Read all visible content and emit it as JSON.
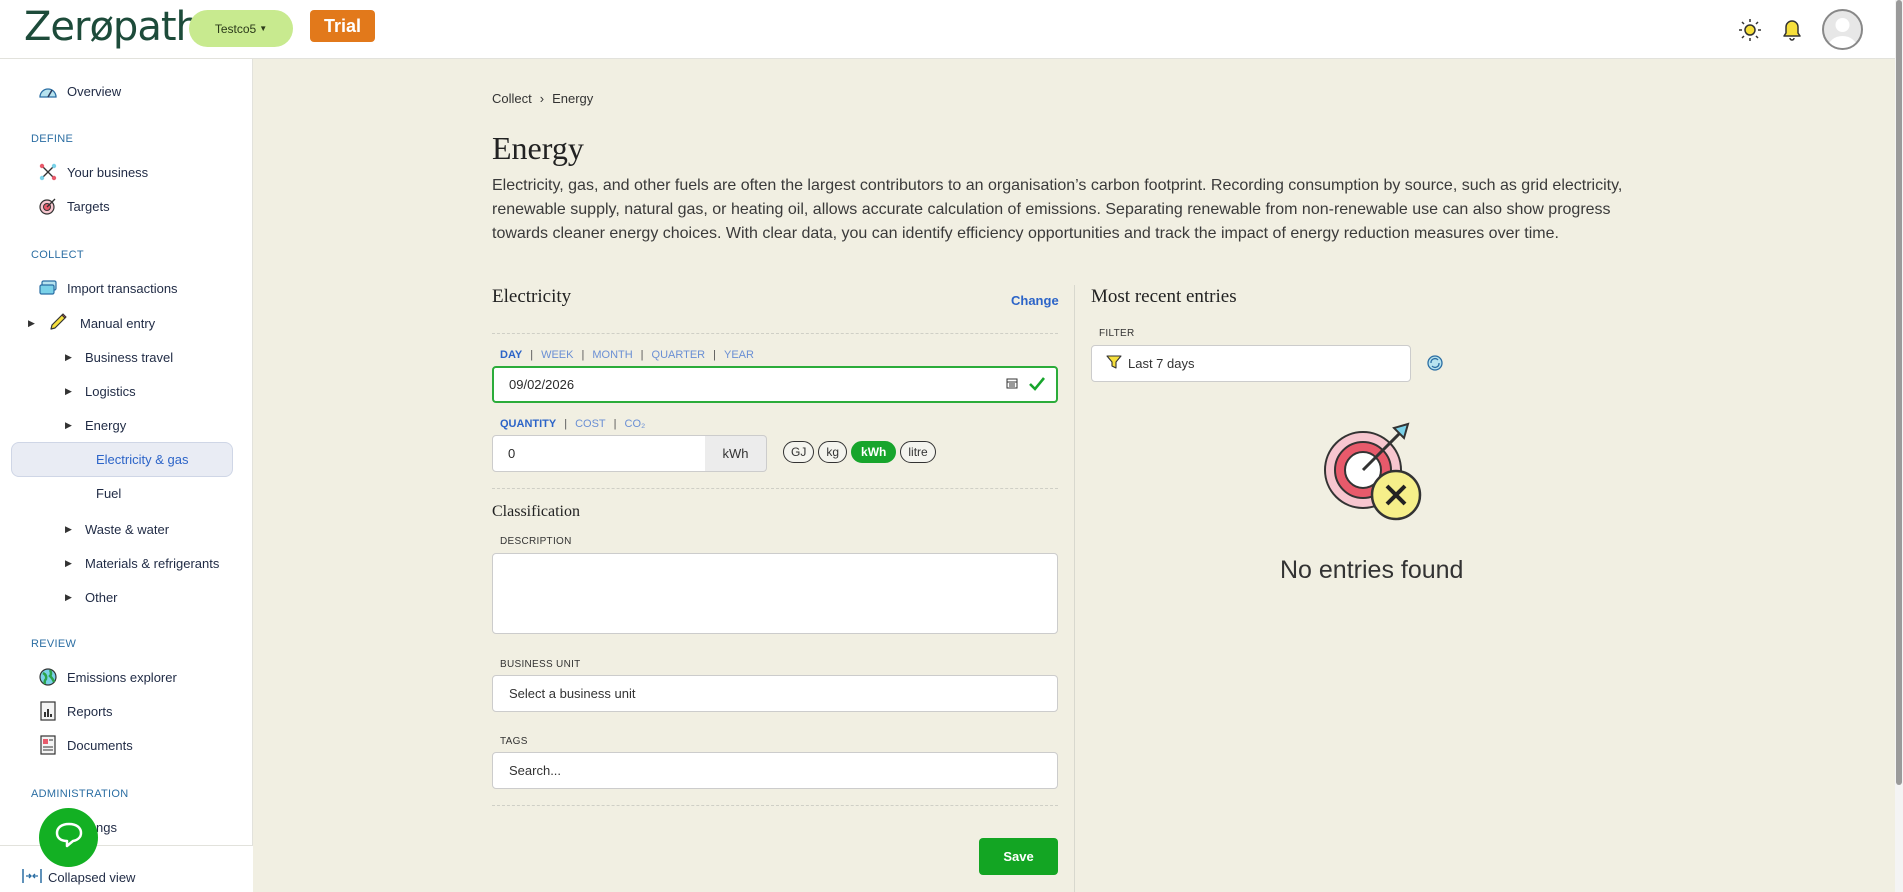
{
  "header": {
    "logo_text": "Zerøpath",
    "org_label": "Testco5",
    "trial_badge": "Trial"
  },
  "sidebar": {
    "overview": "Overview",
    "define_heading": "DEFINE",
    "your_business": "Your business",
    "targets": "Targets",
    "collect_heading": "COLLECT",
    "import_transactions": "Import transactions",
    "manual_entry": "Manual entry",
    "business_travel": "Business travel",
    "logistics": "Logistics",
    "energy": "Energy",
    "electricity_gas": "Electricity & gas",
    "fuel": "Fuel",
    "waste_water": "Waste & water",
    "materials_refrigerants": "Materials & refrigerants",
    "other": "Other",
    "review_heading": "REVIEW",
    "emissions_explorer": "Emissions explorer",
    "reports": "Reports",
    "documents": "Documents",
    "administration_heading": "ADMINISTRATION",
    "settings_partial": "ngs",
    "collapsed_view": "Collapsed view"
  },
  "breadcrumb": {
    "parent": "Collect",
    "separator": "›",
    "current": "Energy"
  },
  "page": {
    "title": "Energy",
    "intro": "Electricity, gas, and other fuels are often the largest contributors to an organisation’s carbon footprint. Recording consumption by source, such as grid electricity, renewable supply, natural gas, or heating oil, allows accurate calculation of emissions. Separating renewable from non-renewable use can also show progress towards cleaner energy choices. With clear data, you can identify efficiency opportunities and track the impact of energy reduction measures over time."
  },
  "form": {
    "title": "Electricity",
    "change_link": "Change",
    "period_tabs": [
      "DAY",
      "WEEK",
      "MONTH",
      "QUARTER",
      "YEAR"
    ],
    "period_separator": "|",
    "date_value": "09/02/2026",
    "measure_tabs": [
      "QUANTITY",
      "COST",
      "CO₂"
    ],
    "quantity_value": "0",
    "unit_addon": "kWh",
    "unit_options": [
      "GJ",
      "kg",
      "kWh",
      "litre"
    ],
    "selected_unit": "kWh",
    "classification_title": "Classification",
    "description_label": "DESCRIPTION",
    "business_unit_label": "BUSINESS UNIT",
    "business_unit_placeholder": "Select a business unit",
    "tags_label": "TAGS",
    "tags_placeholder": "Search...",
    "save_label": "Save"
  },
  "recent": {
    "title": "Most recent entries",
    "filter_label": "FILTER",
    "filter_value": "Last 7 days",
    "empty_text": "No entries found"
  },
  "colors": {
    "accent_green": "#13a523",
    "link_blue": "#2c64c8",
    "trial_orange": "#e2791b",
    "org_green": "#c8ea8f",
    "background": "#f1efe2"
  }
}
